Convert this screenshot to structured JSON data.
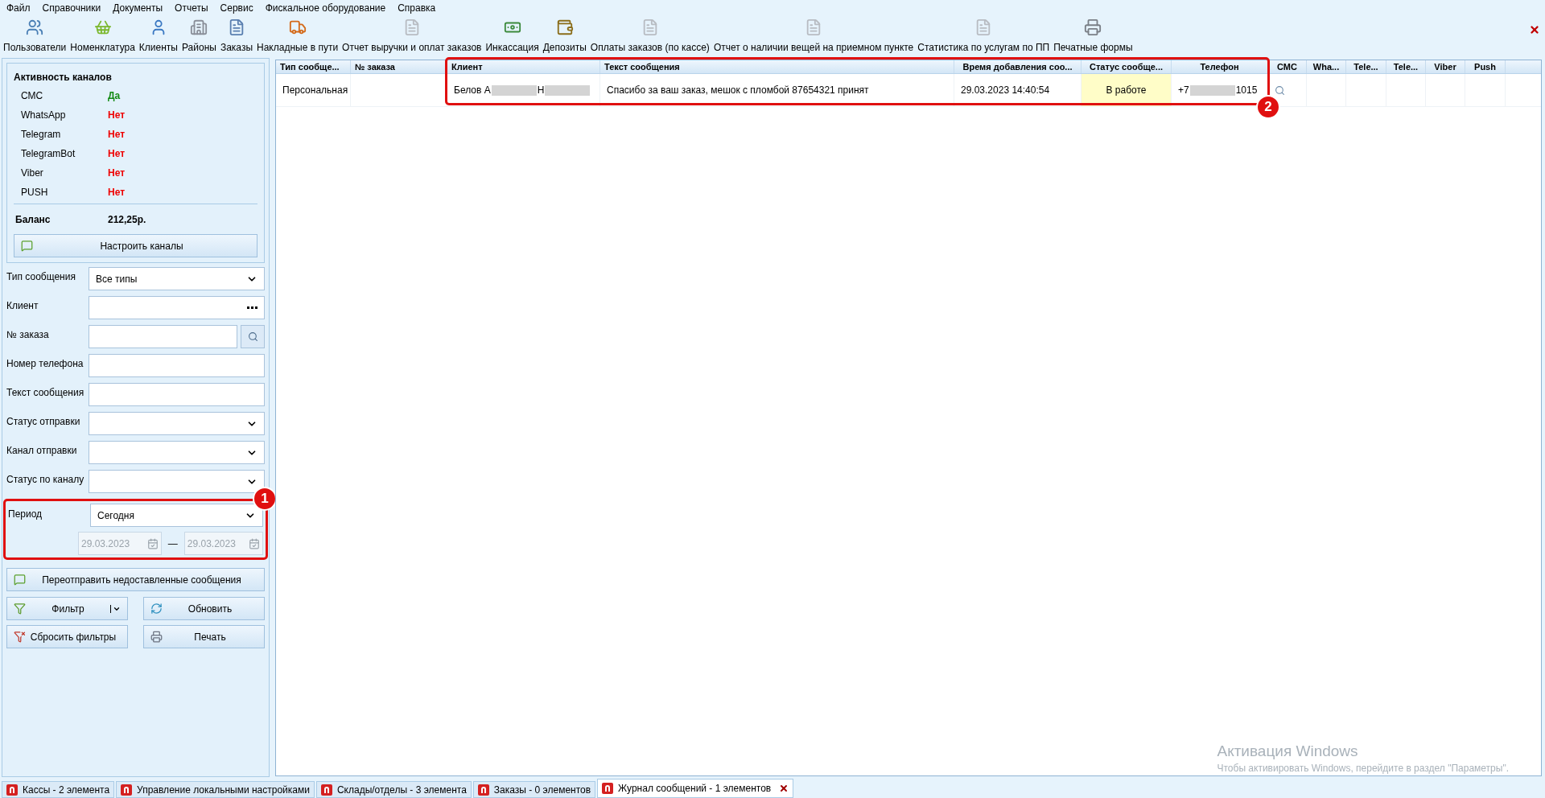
{
  "menu": [
    "Файл",
    "Справочники",
    "Документы",
    "Отчеты",
    "Сервис",
    "Фискальное оборудование",
    "Справка"
  ],
  "toolbar": [
    {
      "label": "Пользователи",
      "kind": "users"
    },
    {
      "label": "Номенклатура",
      "kind": "basket"
    },
    {
      "label": "Клиенты",
      "kind": "person"
    },
    {
      "label": "Районы",
      "kind": "building"
    },
    {
      "label": "Заказы",
      "kind": "document"
    },
    {
      "label": "Накладные в пути",
      "kind": "truck"
    },
    {
      "label": "Отчет выручки и оплат заказов",
      "kind": "report"
    },
    {
      "label": "Инкассация",
      "kind": "money"
    },
    {
      "label": "Депозиты",
      "kind": "wallet"
    },
    {
      "label": "Оплаты заказов (по кассе)",
      "kind": "report"
    },
    {
      "label": "Отчет о наличии вещей на приемном пункте",
      "kind": "report"
    },
    {
      "label": "Статистика по услугам по ПП",
      "kind": "report"
    },
    {
      "label": "Печатные формы",
      "kind": "printer"
    }
  ],
  "channels": {
    "title": "Активность каналов",
    "items": [
      {
        "name": "СМС",
        "value": "Да",
        "active": true
      },
      {
        "name": "WhatsApp",
        "value": "Нет",
        "active": false
      },
      {
        "name": "Telegram",
        "value": "Нет",
        "active": false
      },
      {
        "name": "TelegramBot",
        "value": "Нет",
        "active": false
      },
      {
        "name": "Viber",
        "value": "Нет",
        "active": false
      },
      {
        "name": "PUSH",
        "value": "Нет",
        "active": false
      }
    ],
    "balance_label": "Баланс",
    "balance": "212,25р.",
    "configure_button": "Настроить каналы"
  },
  "filters": [
    {
      "label": "Тип сообщения",
      "kind": "select",
      "value": "Все типы"
    },
    {
      "label": "Клиент",
      "kind": "ellipsis"
    },
    {
      "label": "№ заказа",
      "kind": "search"
    },
    {
      "label": "Номер телефона",
      "kind": "text"
    },
    {
      "label": "Текст сообщения",
      "kind": "text"
    },
    {
      "label": "Статус отправки",
      "kind": "select"
    },
    {
      "label": "Канал отправки",
      "kind": "select"
    },
    {
      "label": "Статус по каналу",
      "kind": "select"
    }
  ],
  "period": {
    "label": "Период",
    "value": "Сегодня",
    "date_from": "29.03.2023",
    "separator": "—",
    "date_to": "29.03.2023",
    "annotation": "1"
  },
  "resend_button": "Переотправить недоставленные сообщения",
  "buttons": [
    {
      "label": "Фильтр",
      "kind": "filter"
    },
    {
      "label": "Обновить",
      "kind": "refresh"
    },
    {
      "label": "Сбросить фильтры",
      "kind": "reset"
    },
    {
      "label": "Печать",
      "kind": "print"
    }
  ],
  "table": {
    "columns": [
      "Тип сообще...",
      "№ заказа",
      "Клиент",
      "Текст сообщения",
      "Время добавления соо...",
      "Статус сообще...",
      "Телефон",
      "СМС",
      "Wha...",
      "Tele...",
      "Tele...",
      "Viber",
      "Push"
    ],
    "rows": [
      {
        "cells": [
          {
            "kind": "text",
            "text": "Персональная"
          },
          {
            "kind": "text",
            "text": ""
          },
          {
            "kind": "segments",
            "segments": [
              {
                "kind": "text",
                "text": "Белов А"
              },
              {
                "kind": "blur"
              },
              {
                "kind": "text",
                "text": "Н"
              },
              {
                "kind": "blur"
              }
            ]
          },
          {
            "kind": "text",
            "text": "Спасибо за ваш заказ, мешок с пломбой 87654321 принят"
          },
          {
            "kind": "text",
            "text": "29.03.2023 14:40:54"
          },
          {
            "kind": "text",
            "text": "В работе",
            "highlighted": true
          },
          {
            "kind": "segments",
            "segments": [
              {
                "kind": "text",
                "text": "+7"
              },
              {
                "kind": "blur"
              },
              {
                "kind": "text",
                "text": "1015"
              }
            ]
          },
          {
            "kind": "icon"
          },
          {
            "kind": "text",
            "text": ""
          },
          {
            "kind": "text",
            "text": ""
          },
          {
            "kind": "text",
            "text": ""
          },
          {
            "kind": "text",
            "text": ""
          },
          {
            "kind": "text",
            "text": ""
          }
        ]
      }
    ],
    "annotation": "2"
  },
  "activation": {
    "title": "Активация Windows",
    "text": "Чтобы активировать Windows, перейдите в раздел \"Параметры\"."
  },
  "tabs": [
    {
      "label": "Кассы - 2 элемента",
      "selected": false
    },
    {
      "label": "Управление локальными настройками",
      "selected": false
    },
    {
      "label": "Склады/отделы - 3 элемента",
      "selected": false
    },
    {
      "label": "Заказы - 0 элементов",
      "selected": false
    },
    {
      "label": "Журнал сообщений - 1 элементов",
      "selected": true
    }
  ]
}
